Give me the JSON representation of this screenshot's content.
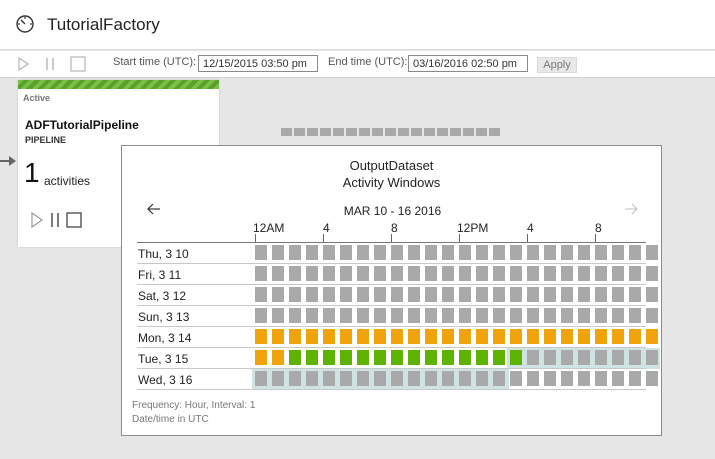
{
  "app": {
    "title": "TutorialFactory",
    "icon": "gauge-icon"
  },
  "toolbar": {
    "play_icon": "play-icon",
    "pause_icon": "pause-icon",
    "stop_icon": "stop-icon",
    "start_label": "Start time (UTC):",
    "start_value": "12/15/2015 03:50 pm",
    "end_label": "End time (UTC):",
    "end_value": "03/16/2016 02:50 pm",
    "apply_label": "Apply"
  },
  "pipeline": {
    "status": "Active",
    "name": "ADFTutorialPipeline",
    "type": "PIPELINE",
    "activity_count": "1",
    "activity_label": "activities"
  },
  "popup": {
    "title": "OutputDataset",
    "subtitle": "Activity Windows",
    "range": "MAR 10 - 16 2016",
    "hour_labels": [
      "12AM",
      "4",
      "8",
      "12PM",
      "4",
      "8"
    ],
    "rows": [
      {
        "label": "Thu, 3 10",
        "cells": "gggggggggggggggggggggggg"
      },
      {
        "label": "Fri, 3 11",
        "cells": "gggggggggggggggggggggggg"
      },
      {
        "label": "Sat, 3 12",
        "cells": "gggggggggggggggggggggggg"
      },
      {
        "label": "Sun, 3 13",
        "cells": "gggggggggggggggggggggggg"
      },
      {
        "label": "Mon, 3 14",
        "cells": "oooooooooooooooooooooooo"
      },
      {
        "label": "Tue, 3 15",
        "cells": "oossssssssssssssgggggggg"
      },
      {
        "label": "Wed, 3 16",
        "cells": "gggggggggggggggggggggggg"
      }
    ],
    "frequency": "Frequency: Hour, Interval: 1",
    "timezone": "Date/time in UTC"
  },
  "colors": {
    "pending": "#a9a9a9",
    "in_progress": "#f0a30a",
    "succeeded": "#5db300",
    "selection": "#cfe3e3"
  }
}
